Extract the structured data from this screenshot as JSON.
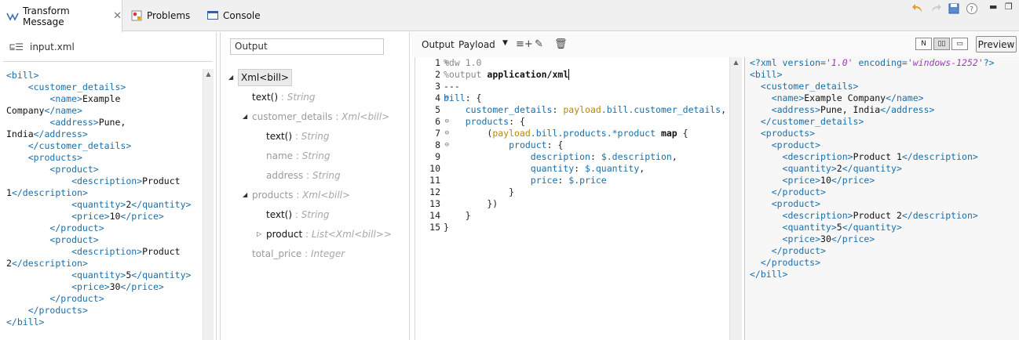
{
  "tabs": {
    "transform": "Transform Message",
    "problems": "Problems",
    "console": "Console"
  },
  "input_panel": {
    "title": "input.xml",
    "xml_lines": [
      [
        {
          "c": "tag",
          "t": "<bill>"
        }
      ],
      [
        {
          "c": "txt",
          "t": "    "
        },
        {
          "c": "tag",
          "t": "<customer_details>"
        }
      ],
      [
        {
          "c": "txt",
          "t": "        "
        },
        {
          "c": "tag",
          "t": "<name>"
        },
        {
          "c": "txt",
          "t": "Example"
        }
      ],
      [
        {
          "c": "txt",
          "t": "Company"
        },
        {
          "c": "tag",
          "t": "</name>"
        }
      ],
      [
        {
          "c": "txt",
          "t": "        "
        },
        {
          "c": "tag",
          "t": "<address>"
        },
        {
          "c": "txt",
          "t": "Pune,"
        }
      ],
      [
        {
          "c": "txt",
          "t": "India"
        },
        {
          "c": "tag",
          "t": "</address>"
        }
      ],
      [
        {
          "c": "txt",
          "t": "    "
        },
        {
          "c": "tag",
          "t": "</customer_details>"
        }
      ],
      [
        {
          "c": "txt",
          "t": "    "
        },
        {
          "c": "tag",
          "t": "<products>"
        }
      ],
      [
        {
          "c": "txt",
          "t": "        "
        },
        {
          "c": "tag",
          "t": "<product>"
        }
      ],
      [
        {
          "c": "txt",
          "t": "            "
        },
        {
          "c": "tag",
          "t": "<description>"
        },
        {
          "c": "txt",
          "t": "Product"
        }
      ],
      [
        {
          "c": "txt",
          "t": "1"
        },
        {
          "c": "tag",
          "t": "</description>"
        }
      ],
      [
        {
          "c": "txt",
          "t": "            "
        },
        {
          "c": "tag",
          "t": "<quantity>"
        },
        {
          "c": "txt",
          "t": "2"
        },
        {
          "c": "tag",
          "t": "</quantity>"
        }
      ],
      [
        {
          "c": "txt",
          "t": "            "
        },
        {
          "c": "tag",
          "t": "<price>"
        },
        {
          "c": "txt",
          "t": "10"
        },
        {
          "c": "tag",
          "t": "</price>"
        }
      ],
      [
        {
          "c": "txt",
          "t": "        "
        },
        {
          "c": "tag",
          "t": "</product>"
        }
      ],
      [
        {
          "c": "txt",
          "t": "        "
        },
        {
          "c": "tag",
          "t": "<product>"
        }
      ],
      [
        {
          "c": "txt",
          "t": "            "
        },
        {
          "c": "tag",
          "t": "<description>"
        },
        {
          "c": "txt",
          "t": "Product"
        }
      ],
      [
        {
          "c": "txt",
          "t": "2"
        },
        {
          "c": "tag",
          "t": "</description>"
        }
      ],
      [
        {
          "c": "txt",
          "t": "            "
        },
        {
          "c": "tag",
          "t": "<quantity>"
        },
        {
          "c": "txt",
          "t": "5"
        },
        {
          "c": "tag",
          "t": "</quantity>"
        }
      ],
      [
        {
          "c": "txt",
          "t": "            "
        },
        {
          "c": "tag",
          "t": "<price>"
        },
        {
          "c": "txt",
          "t": "30"
        },
        {
          "c": "tag",
          "t": "</price>"
        }
      ],
      [
        {
          "c": "txt",
          "t": "        "
        },
        {
          "c": "tag",
          "t": "</product>"
        }
      ],
      [
        {
          "c": "txt",
          "t": "    "
        },
        {
          "c": "tag",
          "t": "</products>"
        }
      ],
      [
        {
          "c": "tag",
          "t": "</bill>"
        }
      ]
    ]
  },
  "output_tree": {
    "search_value": "Output",
    "nodes": [
      {
        "level": 0,
        "twisty": "expanded",
        "name": "Xml<bill>",
        "type": "",
        "selected": true,
        "dim": false
      },
      {
        "level": 1,
        "twisty": "",
        "name": "text()",
        "type": "String",
        "selected": false,
        "dim": false
      },
      {
        "level": 1,
        "twisty": "expanded",
        "name": "customer_details",
        "type": "Xml<bill>",
        "selected": false,
        "dim": true
      },
      {
        "level": 2,
        "twisty": "",
        "name": "text()",
        "type": "String",
        "selected": false,
        "dim": false
      },
      {
        "level": 2,
        "twisty": "",
        "name": "name",
        "type": "String",
        "selected": false,
        "dim": true
      },
      {
        "level": 2,
        "twisty": "",
        "name": "address",
        "type": "String",
        "selected": false,
        "dim": true
      },
      {
        "level": 1,
        "twisty": "expanded",
        "name": "products",
        "type": "Xml<bill>",
        "selected": false,
        "dim": true
      },
      {
        "level": 2,
        "twisty": "",
        "name": "text()",
        "type": "String",
        "selected": false,
        "dim": false
      },
      {
        "level": 2,
        "twisty": "collapsed",
        "name": "product",
        "type": "List<Xml<bill>>",
        "selected": false,
        "dim": false
      },
      {
        "level": 1,
        "twisty": "",
        "name": "total_price",
        "type": "Integer",
        "selected": false,
        "dim": true
      }
    ]
  },
  "script_header": {
    "output_label": "Output",
    "payload_label": "Payload",
    "preview_button": "Preview"
  },
  "script": {
    "line_numbers": [
      "1",
      "2",
      "3",
      "4",
      "5",
      "6",
      "7",
      "8",
      "9",
      "10",
      "11",
      "12",
      "13",
      "14",
      "15"
    ],
    "folds": {
      "1": true,
      "4": true,
      "6": true,
      "7": true,
      "8": true
    },
    "lines": [
      [
        {
          "c": "c-dir",
          "t": "%dw 1.0"
        }
      ],
      [
        {
          "c": "c-dir",
          "t": "%output "
        },
        {
          "c": "c-kw c-cur",
          "t": "application/xml"
        }
      ],
      [
        {
          "c": "c-br",
          "t": "---"
        }
      ],
      [
        {
          "c": "c-id",
          "t": "bill"
        },
        {
          "c": "c-br",
          "t": ": {"
        }
      ],
      [
        {
          "c": "c-br",
          "t": "    "
        },
        {
          "c": "c-id",
          "t": "customer_details"
        },
        {
          "c": "c-br",
          "t": ": "
        },
        {
          "c": "c-pl",
          "t": "payload"
        },
        {
          "c": "c-id",
          "t": ".bill.customer_details"
        },
        {
          "c": "c-br",
          "t": ","
        }
      ],
      [
        {
          "c": "c-br",
          "t": "    "
        },
        {
          "c": "c-id",
          "t": "products"
        },
        {
          "c": "c-br",
          "t": ": {"
        }
      ],
      [
        {
          "c": "c-br",
          "t": "        ("
        },
        {
          "c": "c-pl",
          "t": "payload"
        },
        {
          "c": "c-id",
          "t": ".bill.products.*product "
        },
        {
          "c": "c-kw",
          "t": "map"
        },
        {
          "c": "c-br",
          "t": " {"
        }
      ],
      [
        {
          "c": "c-br",
          "t": "            "
        },
        {
          "c": "c-id",
          "t": "product"
        },
        {
          "c": "c-br",
          "t": ": {"
        }
      ],
      [
        {
          "c": "c-br",
          "t": "                "
        },
        {
          "c": "c-id",
          "t": "description"
        },
        {
          "c": "c-br",
          "t": ": "
        },
        {
          "c": "c-id",
          "t": "$.description"
        },
        {
          "c": "c-br",
          "t": ","
        }
      ],
      [
        {
          "c": "c-br",
          "t": "                "
        },
        {
          "c": "c-id",
          "t": "quantity"
        },
        {
          "c": "c-br",
          "t": ": "
        },
        {
          "c": "c-id",
          "t": "$.quantity"
        },
        {
          "c": "c-br",
          "t": ","
        }
      ],
      [
        {
          "c": "c-br",
          "t": "                "
        },
        {
          "c": "c-id",
          "t": "price"
        },
        {
          "c": "c-br",
          "t": ": "
        },
        {
          "c": "c-id",
          "t": "$.price"
        }
      ],
      [
        {
          "c": "c-br",
          "t": "            }"
        }
      ],
      [
        {
          "c": "c-br",
          "t": "        })"
        }
      ],
      [
        {
          "c": "c-br",
          "t": "    }"
        }
      ],
      [
        {
          "c": "c-br",
          "t": "}"
        }
      ]
    ]
  },
  "preview": {
    "lines": [
      [
        {
          "c": "p-pi",
          "t": "<?xml version="
        },
        {
          "c": "p-str",
          "t": "'1.0'"
        },
        {
          "c": "p-pi",
          "t": " encoding="
        },
        {
          "c": "p-str",
          "t": "'windows-1252'"
        },
        {
          "c": "p-pi",
          "t": "?>"
        }
      ],
      [
        {
          "c": "tag",
          "t": "<bill>"
        }
      ],
      [
        {
          "c": "txt",
          "t": "  "
        },
        {
          "c": "tag",
          "t": "<customer_details>"
        }
      ],
      [
        {
          "c": "txt",
          "t": "    "
        },
        {
          "c": "tag",
          "t": "<name>"
        },
        {
          "c": "txt",
          "t": "Example Company"
        },
        {
          "c": "tag",
          "t": "</name>"
        }
      ],
      [
        {
          "c": "txt",
          "t": "    "
        },
        {
          "c": "tag",
          "t": "<address>"
        },
        {
          "c": "txt",
          "t": "Pune, India"
        },
        {
          "c": "tag",
          "t": "</address>"
        }
      ],
      [
        {
          "c": "txt",
          "t": "  "
        },
        {
          "c": "tag",
          "t": "</customer_details>"
        }
      ],
      [
        {
          "c": "txt",
          "t": "  "
        },
        {
          "c": "tag",
          "t": "<products>"
        }
      ],
      [
        {
          "c": "txt",
          "t": "    "
        },
        {
          "c": "tag",
          "t": "<product>"
        }
      ],
      [
        {
          "c": "txt",
          "t": "      "
        },
        {
          "c": "tag",
          "t": "<description>"
        },
        {
          "c": "txt",
          "t": "Product 1"
        },
        {
          "c": "tag",
          "t": "</description>"
        }
      ],
      [
        {
          "c": "txt",
          "t": "      "
        },
        {
          "c": "tag",
          "t": "<quantity>"
        },
        {
          "c": "txt",
          "t": "2"
        },
        {
          "c": "tag",
          "t": "</quantity>"
        }
      ],
      [
        {
          "c": "txt",
          "t": "      "
        },
        {
          "c": "tag",
          "t": "<price>"
        },
        {
          "c": "txt",
          "t": "10"
        },
        {
          "c": "tag",
          "t": "</price>"
        }
      ],
      [
        {
          "c": "txt",
          "t": "    "
        },
        {
          "c": "tag",
          "t": "</product>"
        }
      ],
      [
        {
          "c": "txt",
          "t": "    "
        },
        {
          "c": "tag",
          "t": "<product>"
        }
      ],
      [
        {
          "c": "txt",
          "t": "      "
        },
        {
          "c": "tag",
          "t": "<description>"
        },
        {
          "c": "txt",
          "t": "Product 2"
        },
        {
          "c": "tag",
          "t": "</description>"
        }
      ],
      [
        {
          "c": "txt",
          "t": "      "
        },
        {
          "c": "tag",
          "t": "<quantity>"
        },
        {
          "c": "txt",
          "t": "5"
        },
        {
          "c": "tag",
          "t": "</quantity>"
        }
      ],
      [
        {
          "c": "txt",
          "t": "      "
        },
        {
          "c": "tag",
          "t": "<price>"
        },
        {
          "c": "txt",
          "t": "30"
        },
        {
          "c": "tag",
          "t": "</price>"
        }
      ],
      [
        {
          "c": "txt",
          "t": "    "
        },
        {
          "c": "tag",
          "t": "</product>"
        }
      ],
      [
        {
          "c": "txt",
          "t": "  "
        },
        {
          "c": "tag",
          "t": "</products>"
        }
      ],
      [
        {
          "c": "tag",
          "t": "</bill>"
        }
      ]
    ]
  },
  "colors": {
    "xml_tag": "#1a6ea8",
    "payload_keyword": "#b8860b",
    "string_literal": "#9b3fb1"
  },
  "icons": {
    "transform_tab": "transform-icon",
    "problems_tab": "problems-icon",
    "console_tab": "console-icon"
  }
}
